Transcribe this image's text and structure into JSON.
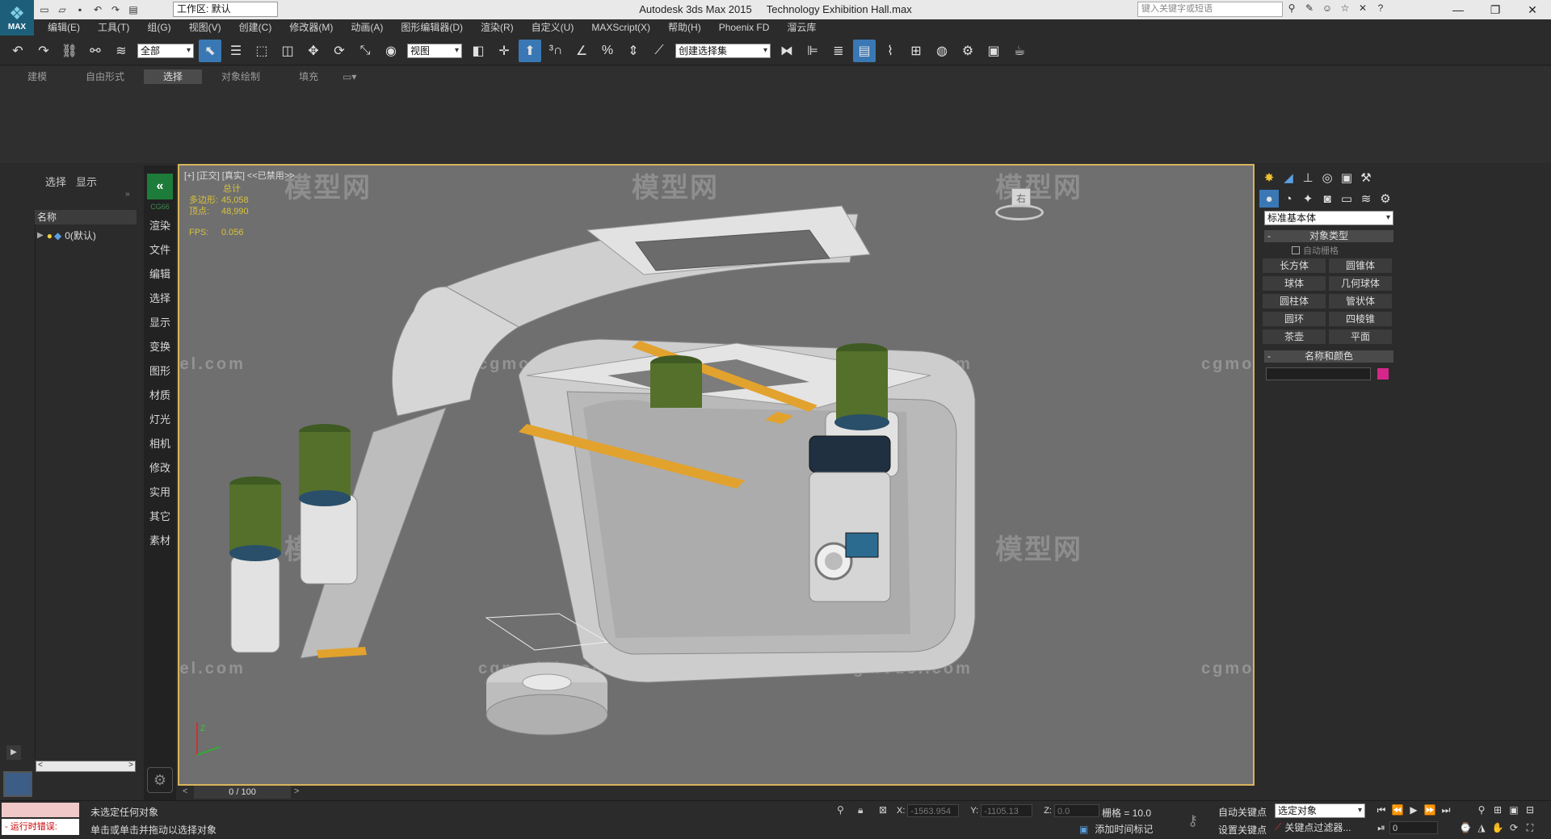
{
  "app": {
    "title": "Autodesk 3ds Max  2015",
    "file": "Technology Exhibition Hall.max",
    "workspace": "工作区: 默认",
    "search_placeholder": "键入关键字或短语",
    "logo_text": "MAX"
  },
  "menus": [
    "编辑(E)",
    "工具(T)",
    "组(G)",
    "视图(V)",
    "创建(C)",
    "修改器(M)",
    "动画(A)",
    "图形编辑器(D)",
    "渲染(R)",
    "自定义(U)",
    "MAXScript(X)",
    "帮助(H)",
    "Phoenix FD",
    "溜云库"
  ],
  "toolbar": {
    "selection_filter": "全部",
    "ref_coord": "视图",
    "named_selection": "创建选择集"
  },
  "ribbon_tabs": [
    {
      "label": "建模",
      "selected": false
    },
    {
      "label": "自由形式",
      "selected": false
    },
    {
      "label": "选择",
      "selected": true
    },
    {
      "label": "对象绘制",
      "selected": false
    },
    {
      "label": "填充",
      "selected": false
    }
  ],
  "scene_explorer": {
    "tabs": [
      "选择",
      "显示"
    ],
    "column_header": "名称",
    "items": [
      {
        "label": "0(默认)"
      }
    ]
  },
  "command_strip": {
    "top_label": "CG66",
    "items": [
      "渲染",
      "文件",
      "编辑",
      "选择",
      "显示",
      "变换",
      "图形",
      "材质",
      "灯光",
      "相机",
      "修改",
      "实用",
      "其它",
      "素材"
    ]
  },
  "viewport": {
    "label": "[+] [正交] [真实] <<已禁用>>",
    "stats_title": "总计",
    "polys_label": "多边形:",
    "polys_value": "45,058",
    "verts_label": "顶点:",
    "verts_value": "48,990",
    "fps_label": "FPS:",
    "fps_value": "0.056",
    "viewcube_label": "右",
    "watermark_logo": "模型网",
    "watermark_url": "cgmodel.com"
  },
  "command_panel": {
    "category": "标准基本体",
    "rollout_object_type": "对象类型",
    "autogrid": "自动栅格",
    "object_buttons": [
      "长方体",
      "圆锥体",
      "球体",
      "几何球体",
      "圆柱体",
      "管状体",
      "圆环",
      "四棱锥",
      "茶壶",
      "平面"
    ],
    "rollout_name_color": "名称和颜色",
    "color_swatch": "#d6268b"
  },
  "timeline": {
    "frame": "0 / 100"
  },
  "status": {
    "error_label": "运行时错误:",
    "selection_status": "未选定任何对象",
    "prompt": "单击或单击并拖动以选择对象",
    "x_label": "X:",
    "x_value": "-1563.954",
    "y_label": "Y:",
    "y_value": "-1105.13",
    "z_label": "Z:",
    "z_value": "0.0",
    "grid": "栅格 = 10.0",
    "add_time_tag": "添加时间标记",
    "auto_key": "自动关键点",
    "set_key": "设置关键点",
    "selected_object": "选定对象",
    "key_filters": "关键点过滤器...",
    "frame_value": "0"
  }
}
